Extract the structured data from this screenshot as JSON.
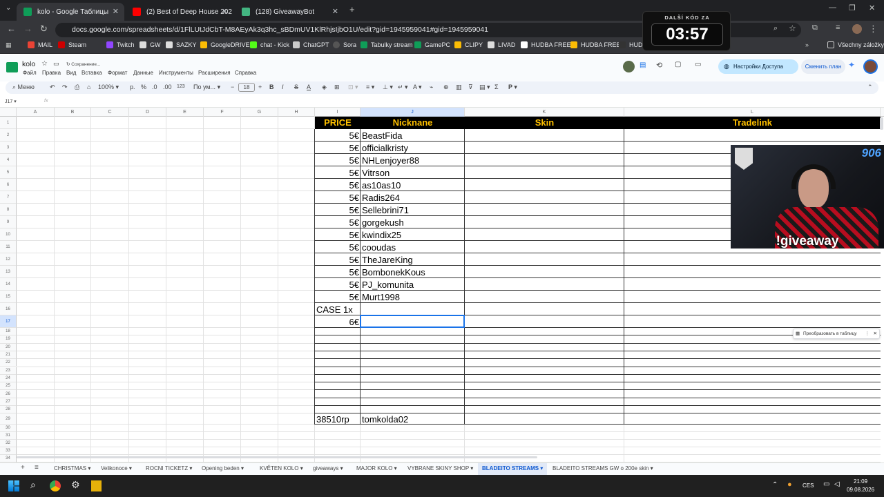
{
  "browser": {
    "tabs": [
      {
        "title": "kolo - Google Таблицы",
        "active": true,
        "color": "#0f9d58"
      },
      {
        "title": "(2) Best of Deep House 202",
        "active": false,
        "color": "#ff0000"
      },
      {
        "title": "(128) GiveawayBot",
        "active": false,
        "color": "#43b581"
      }
    ],
    "url": "docs.google.com/spreadsheets/d/1FlLUtJdCbT-M8AEyAk3q3hc_sBDmUV1KlRhjsIjbO1U/edit?gid=1945959041#gid=1945959041",
    "bookmarks": [
      "MAIL",
      "Steam",
      "Twitch",
      "GW",
      "SAZKY",
      "GoogleDRIVE",
      "chat - Kick",
      "ChatGPT",
      "Sora",
      "Tabulky stream",
      "GamePC",
      "CLIPY",
      "LIVAD",
      "HUDBA FREE",
      "HUDBA FREE",
      "HUDE"
    ],
    "all_bookmarks": "Všechny záložky"
  },
  "timer": {
    "label": "DALŠÍ KÓD ZA",
    "value": "03:57"
  },
  "sheets": {
    "title": "kolo",
    "saving": "Сохранение...",
    "menu": [
      "Файл",
      "Правка",
      "Вид",
      "Вставка",
      "Формат",
      "Данные",
      "Инструменты",
      "Расширения",
      "Справка"
    ],
    "access_button": "Настройки Доступа",
    "plan_button": "Сменить план",
    "toolbar": {
      "menu": "Меню",
      "zoom": "100%",
      "p": "р.",
      "pct": "%",
      "dec1": ".0",
      "dec2": ".00",
      "num": "123",
      "font": "По ум...",
      "size": "18"
    },
    "namebox": "J17",
    "fx": "fx",
    "columns": [
      "A",
      "B",
      "C",
      "D",
      "E",
      "F",
      "G",
      "H",
      "I",
      "J",
      "K",
      "L"
    ],
    "headers": {
      "price": "PRICE",
      "nick": "Nicknane",
      "skin": "Skin",
      "trade": "Tradelink"
    },
    "rows": [
      {
        "price": "5€",
        "nick": "BeastFida"
      },
      {
        "price": "5€",
        "nick": "officialkristy"
      },
      {
        "price": "5€",
        "nick": "NHLenjoyer88"
      },
      {
        "price": "5€",
        "nick": "Vitrson"
      },
      {
        "price": "5€",
        "nick": "as10as10"
      },
      {
        "price": "5€",
        "nick": "Radis264"
      },
      {
        "price": "5€",
        "nick": "Sellebrini71"
      },
      {
        "price": "5€",
        "nick": "gorgekush"
      },
      {
        "price": "5€",
        "nick": "kwindix25"
      },
      {
        "price": "5€",
        "nick": "cooudas"
      },
      {
        "price": "5€",
        "nick": "TheJareKing"
      },
      {
        "price": "5€",
        "nick": "BombonekKous"
      },
      {
        "price": "5€",
        "nick": "PJ_komunita"
      },
      {
        "price": "5€",
        "nick": "Murt1998"
      }
    ],
    "row16": "CASE 1x",
    "row17": "6€",
    "row29": {
      "price": "38510rp",
      "nick": "tomkolda02"
    },
    "convert_popup": "Преобразовать в таблицу",
    "sheet_tabs": [
      "CHRISTMAS",
      "Velikonoce",
      "ROCNI TICKETZ",
      "Opening beden",
      "KVĚTEN KOLO",
      "giveaways",
      "MAJOR KOLO",
      "VYBRANE SKINY SHOP",
      "BLADEITO STREAMS",
      "BLADEITO STREAMS GW o 200e skin"
    ],
    "active_sheet": "BLADEITO STREAMS"
  },
  "stream": {
    "overlay_text": "!giveaway",
    "count": "906"
  },
  "taskbar": {
    "lang": "CES",
    "time": "21:09",
    "date": "09.08.2026"
  }
}
